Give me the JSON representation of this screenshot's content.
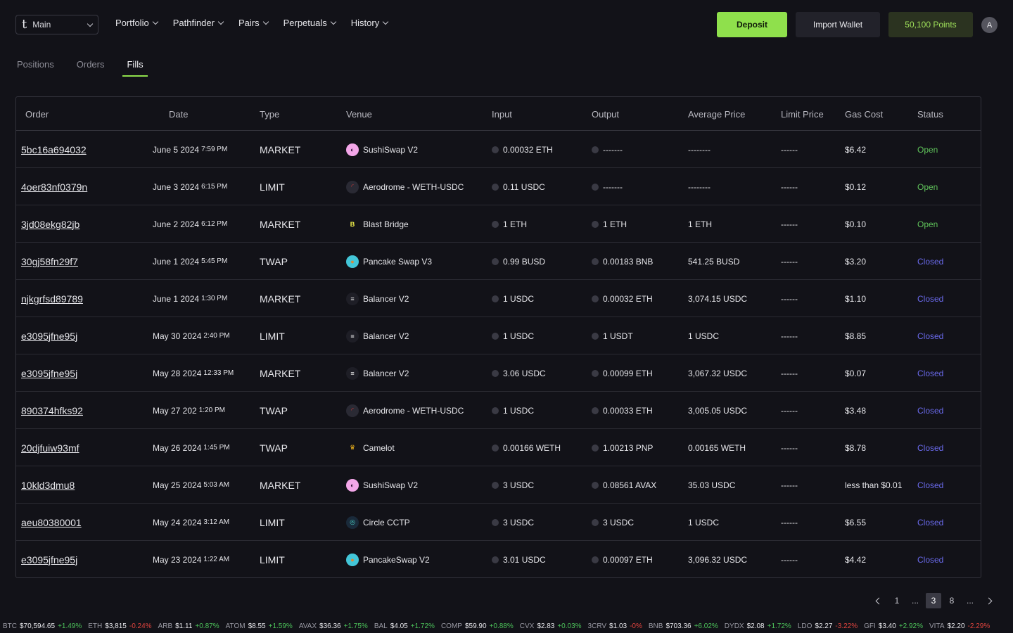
{
  "header": {
    "account": "Main",
    "nav": [
      "Portfolio",
      "Pathfinder",
      "Pairs",
      "Perpetuals",
      "History"
    ],
    "deposit_label": "Deposit",
    "import_label": "Import Wallet",
    "points_label": "50,100 Points",
    "avatar": "A"
  },
  "tabs": [
    "Positions",
    "Orders",
    "Fills"
  ],
  "table": {
    "columns": [
      "Order",
      "Date",
      "Type",
      "Venue",
      "Input",
      "Output",
      "Average Price",
      "Limit Price",
      "Gas Cost",
      "Status"
    ],
    "rows": [
      {
        "order": "5bc16a694032",
        "date": "June 5 2024",
        "time": "7:59 PM",
        "type": "MARKET",
        "venue": "SushiSwap V2",
        "venue_icon": "sushiswap-icon",
        "input": "0.00032  ETH",
        "output": "-------",
        "avg": "--------",
        "limit": "------",
        "gas": "$6.42",
        "status": "Open"
      },
      {
        "order": "4oer83nf0379n",
        "date": "June 3 2024",
        "time": "6:15 PM",
        "type": "LIMIT",
        "venue": "Aerodrome - WETH-USDC",
        "venue_icon": "aerodrome-icon",
        "input": "0.11 USDC",
        "output": "-------",
        "avg": "--------",
        "limit": "------",
        "gas": "$0.12",
        "status": "Open"
      },
      {
        "order": "3jd08ekg82jb",
        "date": "June 2 2024",
        "time": "6:12 PM",
        "type": "MARKET",
        "venue": "Blast Bridge",
        "venue_icon": "blast-icon",
        "input": "1 ETH",
        "output": "1 ETH",
        "avg": "1 ETH",
        "limit": "------",
        "gas": "$0.10",
        "status": "Open"
      },
      {
        "order": "30gj58fn29f7",
        "date": "June 1 2024",
        "time": "5:45 PM",
        "type": "TWAP",
        "venue": "Pancake Swap V3",
        "venue_icon": "pancakeswap-icon",
        "input": "0.99 BUSD",
        "output": "0.00183 BNB",
        "avg": "541.25 BUSD",
        "limit": "------",
        "gas": "$3.20",
        "status": "Closed"
      },
      {
        "order": "njkgrfsd89789",
        "date": "June 1 2024",
        "time": "1:30 PM",
        "type": "MARKET",
        "venue": "Balancer V2",
        "venue_icon": "balancer-icon",
        "input": "1 USDC",
        "output": "0.00032 ETH",
        "avg": "3,074.15 USDC",
        "limit": "------",
        "gas": "$1.10",
        "status": "Closed"
      },
      {
        "order": "e3095jfne95j",
        "date": "May 30 2024",
        "time": "2:40 PM",
        "type": "LIMIT",
        "venue": "Balancer V2",
        "venue_icon": "balancer-icon",
        "input": "1 USDC",
        "output": "1 USDT",
        "avg": "1 USDC",
        "limit": "------",
        "gas": "$8.85",
        "status": "Closed"
      },
      {
        "order": "e3095jfne95j",
        "date": "May 28 2024",
        "time": "12:33 PM",
        "type": "MARKET",
        "venue": "Balancer V2",
        "venue_icon": "balancer-icon",
        "input": "3.06 USDC",
        "output": "0.00099 ETH",
        "avg": "3,067.32 USDC",
        "limit": "------",
        "gas": "$0.07",
        "status": "Closed"
      },
      {
        "order": "890374hfks92",
        "date": "May 27 202",
        "time": "1:20 PM",
        "type": "TWAP",
        "venue": "Aerodrome - WETH-USDC",
        "venue_icon": "aerodrome-icon",
        "input": "1 USDC",
        "output": "0.00033 ETH",
        "avg": "3,005.05 USDC",
        "limit": "------",
        "gas": "$3.48",
        "status": "Closed"
      },
      {
        "order": "20djfuiw93mf",
        "date": "May 26 2024",
        "time": "1:45 PM",
        "type": "TWAP",
        "venue": "Camelot",
        "venue_icon": "camelot-icon",
        "input": "0.00166 WETH",
        "output": "1.00213 PNP",
        "avg": "0.00165 WETH",
        "limit": "------",
        "gas": "$8.78",
        "status": "Closed"
      },
      {
        "order": "10kld3dmu8",
        "date": "May 25 2024",
        "time": "5:03 AM",
        "type": "MARKET",
        "venue": "SushiSwap V2",
        "venue_icon": "sushiswap-icon",
        "input": "3 USDC",
        "output": "0.08561 AVAX",
        "avg": "35.03 USDC",
        "limit": "------",
        "gas": "less than $0.01",
        "status": "Closed"
      },
      {
        "order": "aeu80380001",
        "date": "May 24 2024",
        "time": "3:12 AM",
        "type": "LIMIT",
        "venue": "Circle CCTP",
        "venue_icon": "circle-icon",
        "input": "3 USDC",
        "output": "3 USDC",
        "avg": "1 USDC",
        "limit": "------",
        "gas": "$6.55",
        "status": "Closed"
      },
      {
        "order": "e3095jfne95j",
        "date": "May 23 2024",
        "time": "1:22 AM",
        "type": "LIMIT",
        "venue": "PancakeSwap V2",
        "venue_icon": "pancakeswap-icon",
        "input": "3.01 USDC",
        "output": "0.00097 ETH",
        "avg": "3,096.32 USDC",
        "limit": "------",
        "gas": "$4.42",
        "status": "Closed"
      }
    ]
  },
  "pagination": [
    "1",
    "...",
    "3",
    "8",
    "..."
  ],
  "pagination_current": "3",
  "ticker": [
    {
      "sym": "BTC",
      "price": "$70,594.65",
      "chg": "+1.49%"
    },
    {
      "sym": "ETH",
      "price": "$3,815",
      "chg": "-0.24%"
    },
    {
      "sym": "ARB",
      "price": "$1.11",
      "chg": "+0.87%"
    },
    {
      "sym": "ATOM",
      "price": "$8.55",
      "chg": "+1.59%"
    },
    {
      "sym": "AVAX",
      "price": "$36.36",
      "chg": "+1.75%"
    },
    {
      "sym": "BAL",
      "price": "$4.05",
      "chg": "+1.72%"
    },
    {
      "sym": "COMP",
      "price": "$59.90",
      "chg": "+0.88%"
    },
    {
      "sym": "CVX",
      "price": "$2.83",
      "chg": "+0.03%"
    },
    {
      "sym": "3CRV",
      "price": "$1.03",
      "chg": "-0%"
    },
    {
      "sym": "BNB",
      "price": "$703.36",
      "chg": "+6.02%"
    },
    {
      "sym": "DYDX",
      "price": "$2.08",
      "chg": "+1.72%"
    },
    {
      "sym": "LDO",
      "price": "$2.27",
      "chg": "-3.22%"
    },
    {
      "sym": "GFI",
      "price": "$3.40",
      "chg": "+2.92%"
    },
    {
      "sym": "VITA",
      "price": "$2.20",
      "chg": "-2.29%"
    }
  ],
  "colors": {
    "accent": "#8fe04c",
    "open": "#5fc25a",
    "closed": "#6a6aec",
    "up": "#4cc25a",
    "down": "#e0443e"
  }
}
